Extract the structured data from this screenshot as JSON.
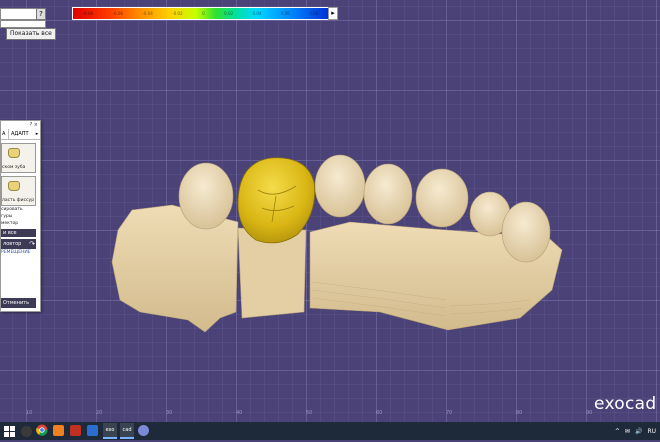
{
  "toolbar": {
    "show_all_label": "Показать все",
    "num_btn": "?"
  },
  "scale": {
    "ticks": [
      "-0.08",
      "-0.06",
      "-0.04",
      "-0.02",
      "0",
      "0.02",
      "0.04",
      "0.06",
      "0.08"
    ],
    "colors": [
      "#e00000",
      "#ff8c00",
      "#ffd000",
      "#30e030",
      "#00d8ff",
      "#0030d8"
    ]
  },
  "panel": {
    "header": "? ×",
    "tab_left": "А",
    "tab_main": "АДАПТ",
    "tab_arrow": "▸",
    "tool1_label": "ском зуба",
    "tool2_label": "ласть фиссур",
    "line1": "сировать",
    "line2": "гуры",
    "line3": "мектор",
    "btn_all": "и все",
    "btn_tool": "ловтор",
    "link": "РЕМЕЩЕНИЕ",
    "footer": "Отменить"
  },
  "axis_labels": [
    "10",
    "20",
    "30",
    "40",
    "50",
    "60",
    "70",
    "80",
    "90"
  ],
  "logo": "exocad",
  "taskbar": {
    "apps": [
      "chrome",
      "orange",
      "rec",
      "blue",
      "exo",
      "cad",
      "globe"
    ],
    "app_labels": [
      "",
      "",
      "",
      "",
      "exo",
      "cad",
      ""
    ],
    "tray_items": [
      "^",
      "✉",
      "🔊",
      "RU"
    ]
  },
  "colors": {
    "background": "#4b4378",
    "tooth": "#e8d5aa",
    "crown": "#e2c21e",
    "panel_dark": "#3d3a56"
  }
}
